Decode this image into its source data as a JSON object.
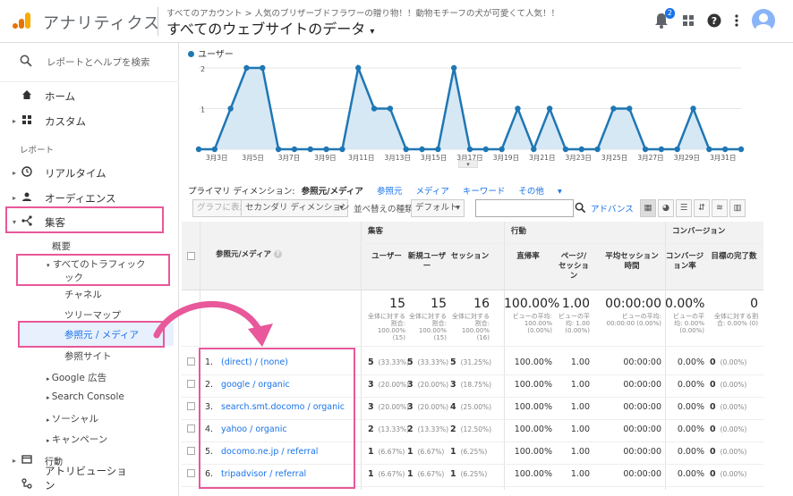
{
  "header": {
    "app_name": "アナリティクス",
    "breadcrumb": "すべてのアカウント > 人気のブリザーブドフラワーの贈り物！！動物モチーフの犬が可愛くて人気！！",
    "view_title": "すべてのウェブサイトのデータ",
    "notification_count": "2"
  },
  "sidebar": {
    "search_placeholder": "レポートとヘルプを検索",
    "home": "ホーム",
    "custom": "カスタム",
    "reports_label": "レポート",
    "realtime": "リアルタイム",
    "audience": "オーディエンス",
    "acquisition": "集客",
    "overview": "概要",
    "all_traffic": "すべてのトラフィック",
    "all_traffic_line2": "ック",
    "channels": "チャネル",
    "treemaps": "ツリーマップ",
    "source_medium": "参照元 / メディア",
    "referrals": "参照サイト",
    "google_ads": "Google 広告",
    "search_console": "Search Console",
    "social": "ソーシャル",
    "campaigns": "キャンペーン",
    "behavior": "行動",
    "attribution": "アトリビューショ",
    "attribution_line2": "ン"
  },
  "chart_data": {
    "type": "line",
    "series": [
      {
        "name": "ユーザー",
        "values": [
          0,
          0,
          1,
          2,
          2,
          0,
          0,
          0,
          0,
          0,
          2,
          1,
          1,
          0,
          0,
          0,
          2,
          0,
          0,
          0,
          1,
          0,
          1,
          0,
          0,
          0,
          1,
          1,
          0,
          0,
          0,
          1,
          0,
          0,
          0
        ]
      }
    ],
    "x": [
      "3月2日",
      "3月3日",
      "3月4日",
      "3月5日",
      "3月6日",
      "3月7日",
      "3月8日",
      "3月9日",
      "3月10日",
      "3月11日",
      "3月12日",
      "3月13日",
      "3月14日",
      "3月15日",
      "3月16日",
      "3月17日",
      "3月18日",
      "3月19日",
      "3月20日",
      "3月21日",
      "3月22日",
      "3月23日",
      "3月24日",
      "3月25日",
      "3月26日",
      "3月27日",
      "3月28日",
      "3月29日",
      "3月30日",
      "3月31日"
    ],
    "tick_labels": [
      "3月3日",
      "3月5日",
      "3月7日",
      "3月9日",
      "3月11日",
      "3月13日",
      "3月15日",
      "3月17日",
      "3月19日",
      "3月21日",
      "3月23日",
      "3月25日",
      "3月27日",
      "3月29日",
      "3月31日"
    ],
    "ytick_labels": [
      "2",
      "1"
    ],
    "ylim": [
      0,
      2
    ],
    "color": "#1f77b4",
    "fill": "#d7e8f5"
  },
  "dimensions": {
    "label": "プライマリ ディメンション:",
    "selected": "参照元/メディア",
    "options": [
      "参照元",
      "メディア",
      "キーワード",
      "その他"
    ]
  },
  "toolbar": {
    "plot_rows": "グラフに表示",
    "secondary_dim": "セカンダリ ディメンション",
    "sort_label": "並べ替えの種類:",
    "sort_value": "デフォルト",
    "advanced": "アドバンス"
  },
  "table": {
    "dim_header": "参照元/メディア",
    "groups": [
      "集客",
      "行動",
      "コンバージョン"
    ],
    "columns": [
      "ユーザー",
      "新規ユーザー",
      "セッション",
      "直帰率",
      "ページ/セッション",
      "平均セッション時間",
      "コンバージョン率",
      "目標の完了数"
    ],
    "totals": [
      {
        "value": "15",
        "note": "全体に対する割合: 100.00% (15)"
      },
      {
        "value": "15",
        "note": "全体に対する割合: 100.00% (15)"
      },
      {
        "value": "16",
        "note": "全体に対する割合: 100.00% (16)"
      },
      {
        "value": "100.00%",
        "note": "ビューの平均: 100.00% (0.00%)"
      },
      {
        "value": "1.00",
        "note": "ビューの平均: 1.00 (0.00%)"
      },
      {
        "value": "00:00:00",
        "note": "ビューの平均: 00:00:00 (0.00%)"
      },
      {
        "value": "0.00%",
        "note": "ビューの平均: 0.00% (0.00%)"
      },
      {
        "value": "0",
        "note": "全体に対する割合: 0.00% (0)"
      }
    ],
    "rows": [
      {
        "idx": "1.",
        "src": "(direct) / (none)",
        "users": "5",
        "users_p": "(33.33%)",
        "new": "5",
        "new_p": "(33.33%)",
        "sess": "5",
        "sess_p": "(31.25%)",
        "bounce": "100.00%",
        "pps": "1.00",
        "dur": "00:00:00",
        "conv": "0.00%",
        "goal": "0",
        "goal_p": "(0.00%)"
      },
      {
        "idx": "2.",
        "src": "google / organic",
        "users": "3",
        "users_p": "(20.00%)",
        "new": "3",
        "new_p": "(20.00%)",
        "sess": "3",
        "sess_p": "(18.75%)",
        "bounce": "100.00%",
        "pps": "1.00",
        "dur": "00:00:00",
        "conv": "0.00%",
        "goal": "0",
        "goal_p": "(0.00%)"
      },
      {
        "idx": "3.",
        "src": "search.smt.docomo / organic",
        "users": "3",
        "users_p": "(20.00%)",
        "new": "3",
        "new_p": "(20.00%)",
        "sess": "4",
        "sess_p": "(25.00%)",
        "bounce": "100.00%",
        "pps": "1.00",
        "dur": "00:00:00",
        "conv": "0.00%",
        "goal": "0",
        "goal_p": "(0.00%)"
      },
      {
        "idx": "4.",
        "src": "yahoo / organic",
        "users": "2",
        "users_p": "(13.33%)",
        "new": "2",
        "new_p": "(13.33%)",
        "sess": "2",
        "sess_p": "(12.50%)",
        "bounce": "100.00%",
        "pps": "1.00",
        "dur": "00:00:00",
        "conv": "0.00%",
        "goal": "0",
        "goal_p": "(0.00%)"
      },
      {
        "idx": "5.",
        "src": "docomo.ne.jp / referral",
        "users": "1",
        "users_p": "(6.67%)",
        "new": "1",
        "new_p": "(6.67%)",
        "sess": "1",
        "sess_p": "(6.25%)",
        "bounce": "100.00%",
        "pps": "1.00",
        "dur": "00:00:00",
        "conv": "0.00%",
        "goal": "0",
        "goal_p": "(0.00%)"
      },
      {
        "idx": "6.",
        "src": "tripadvisor / referral",
        "users": "1",
        "users_p": "(6.67%)",
        "new": "1",
        "new_p": "(6.67%)",
        "sess": "1",
        "sess_p": "(6.25%)",
        "bounce": "100.00%",
        "pps": "1.00",
        "dur": "00:00:00",
        "conv": "0.00%",
        "goal": "0",
        "goal_p": "(0.00%)"
      }
    ]
  },
  "colors": {
    "accent": "#1a73e8",
    "highlight": "#e8589a",
    "logo_orange": "#f9ab00",
    "logo_dark": "#e37400"
  }
}
